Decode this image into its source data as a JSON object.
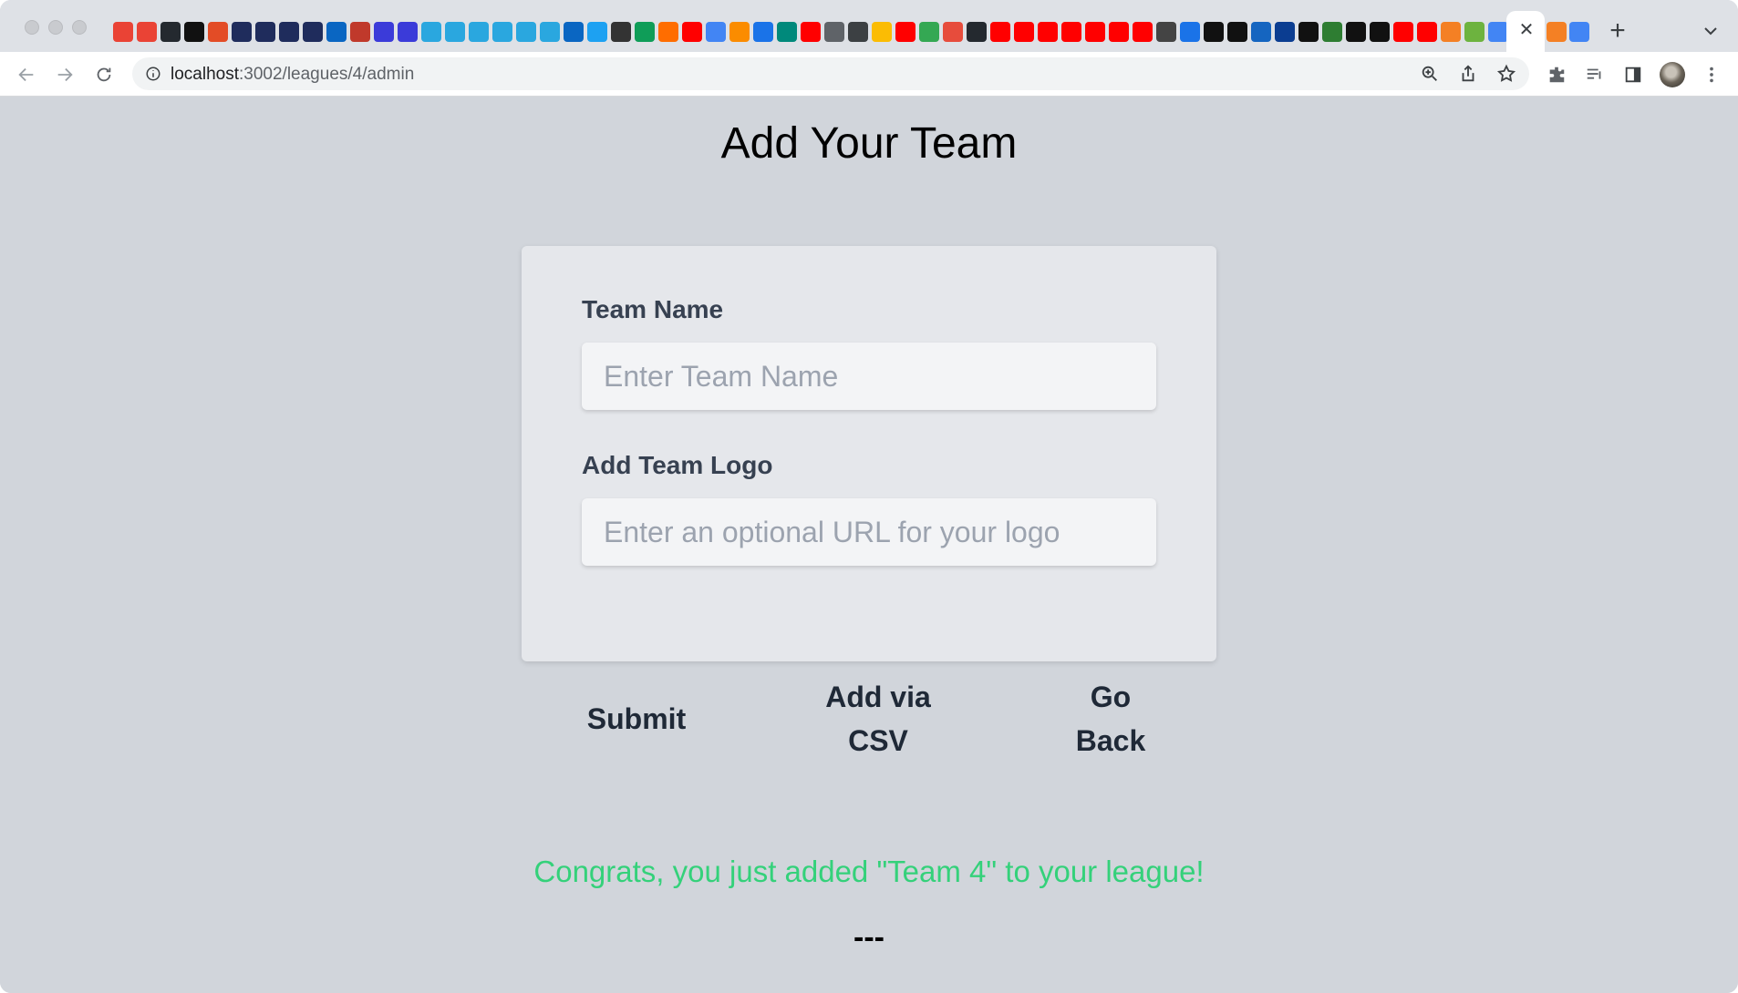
{
  "browser": {
    "url_host": "localhost",
    "url_path": ":3002/leagues/4/admin",
    "tab_close_glyph": "✕",
    "new_tab_glyph": "+",
    "favicon_colors": [
      "#ea4335",
      "#ea4335",
      "#24292f",
      "#111111",
      "#e34c26",
      "#1f2c5c",
      "#1f2c5c",
      "#1f2c5c",
      "#1f2c5c",
      "#0a66c2",
      "#c0392b",
      "#3b3bd9",
      "#3b3bd9",
      "#2aa7df",
      "#2aa7df",
      "#2aa7df",
      "#2aa7df",
      "#2aa7df",
      "#2aa7df",
      "#0a66c2",
      "#1da1f2",
      "#333333",
      "#0f9d58",
      "#ff6d00",
      "#ff0000",
      "#4285f4",
      "#fb8c00",
      "#1a73e8",
      "#00897b",
      "#ff0000",
      "#5f6368",
      "#3c4043",
      "#fbbc04",
      "#ff0000",
      "#34a853",
      "#e74c3c",
      "#24292f",
      "#ff0000",
      "#ff0000",
      "#ff0000",
      "#ff0000",
      "#ff0000",
      "#ff0000",
      "#ff0000",
      "#444444",
      "#1a73e8",
      "#111111",
      "#111111",
      "#1565c0",
      "#0b3d91",
      "#111111",
      "#2e7d32",
      "#111111",
      "#111111",
      "#ff0000",
      "#ff0000",
      "#f48024",
      "#6db33f",
      "#4285f4",
      "#24292f"
    ],
    "tail_favicon_colors": [
      "#f48024",
      "#4285f4"
    ]
  },
  "page": {
    "title": "Add Your Team",
    "form": {
      "team_name_label": "Team Name",
      "team_name_placeholder": "Enter Team Name",
      "team_name_value": "",
      "logo_label": "Add Team Logo",
      "logo_placeholder": "Enter an optional URL for your logo",
      "logo_value": ""
    },
    "buttons": {
      "submit": "Submit",
      "csv_line1": "Add via",
      "csv_line2": "CSV",
      "back_line1": "Go",
      "back_line2": "Back"
    },
    "message": "Congrats, you just added \"Team 4\" to your league!",
    "divider": "---"
  },
  "colors": {
    "page_bg": "#d1d5db",
    "card_bg": "#e5e7eb",
    "success_text": "#34d17a"
  }
}
